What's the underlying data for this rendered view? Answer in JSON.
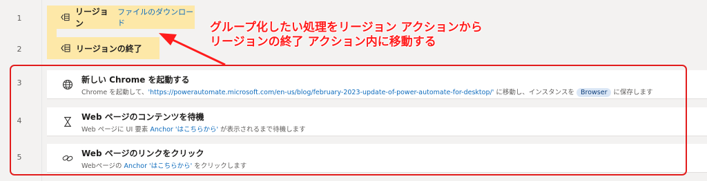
{
  "line_numbers": [
    "1",
    "2",
    "3",
    "4",
    "5"
  ],
  "region_start": {
    "title": "リージョン",
    "name": "ファイルのダウンロード",
    "icon": "region-icon"
  },
  "region_end": {
    "title": "リージョンの終了",
    "icon": "region-icon"
  },
  "annotation": {
    "line1": "グループ化したい処理をリージョン アクションから",
    "line2": "リージョンの終了 アクション内に移動する",
    "color": "#ff1c1c"
  },
  "actions": [
    {
      "icon": "globe-icon",
      "title": "新しい Chrome を起動する",
      "desc_pre": "Chrome を起動して、",
      "desc_link": "'https://powerautomate.microsoft.com/en-us/blog/february-2023-update-of-power-automate-for-desktop/'",
      "desc_mid": " に移動し、インスタンスを ",
      "desc_chip": "Browser",
      "desc_post": " に保存します"
    },
    {
      "icon": "hourglass-icon",
      "title": "Web ページのコンテンツを待機",
      "desc_pre": "Web ページに UI 要素 ",
      "desc_link": "Anchor 'はこちらから'",
      "desc_post": " が表示されるまで待機します"
    },
    {
      "icon": "link-icon",
      "title": "Web ページのリンクをクリック",
      "desc_pre": "Webページの ",
      "desc_link": "Anchor 'はこちらから'",
      "desc_post": " をクリックします"
    }
  ],
  "colors": {
    "region_bg": "#fde8a8",
    "link": "#0f6cbd",
    "highlight_box": "#e21b1b"
  }
}
